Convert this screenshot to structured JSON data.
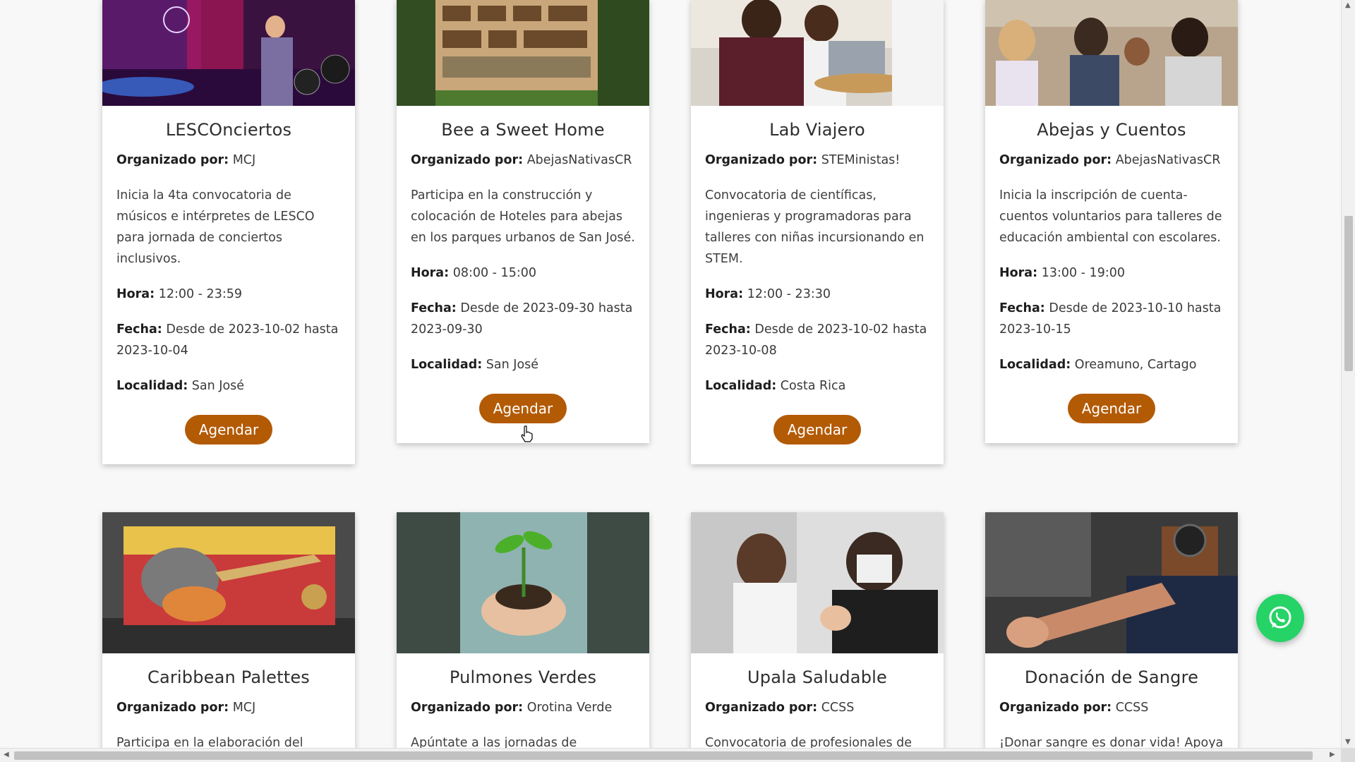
{
  "labels": {
    "organizer": "Organizado por:",
    "hour": "Hora:",
    "date": "Fecha:",
    "location": "Localidad:",
    "button": "Agendar"
  },
  "events": [
    {
      "title": "LESCOnciertos",
      "organizer": "MCJ",
      "description": "Inicia la 4ta convocatoria de músicos e intérpretes de LESCO para jornada de conciertos inclusivos.",
      "hour": "12:00 - 23:59",
      "date": "Desde de 2023-10-02 hasta 2023-10-04",
      "location": "San José"
    },
    {
      "title": "Bee a Sweet Home",
      "organizer": "AbejasNativasCR",
      "description": "Participa en la construcción y colocación de Hoteles para abejas en los parques urbanos de San José.",
      "hour": "08:00 - 15:00",
      "date": "Desde de 2023-09-30 hasta 2023-09-30",
      "location": "San José"
    },
    {
      "title": "Lab Viajero",
      "organizer": "STEMinistas!",
      "description": "Convocatoria de científicas, ingenieras y programadoras para talleres con niñas incursionando en STEM.",
      "hour": "12:00 - 23:30",
      "date": "Desde de 2023-10-02 hasta 2023-10-08",
      "location": "Costa Rica"
    },
    {
      "title": "Abejas y Cuentos",
      "organizer": "AbejasNativasCR",
      "description": "Inicia la inscripción de cuenta-cuentos voluntarios para talleres de educación ambiental con escolares.",
      "hour": "13:00 - 19:00",
      "date": "Desde de 2023-10-10 hasta 2023-10-15",
      "location": "Oreamuno, Cartago"
    },
    {
      "title": "Caribbean Palettes",
      "organizer": "MCJ",
      "description": "Participa en la elaboración del"
    },
    {
      "title": "Pulmones Verdes",
      "organizer": "Orotina Verde",
      "description": "Apúntate a las jornadas de"
    },
    {
      "title": "Upala Saludable",
      "organizer": "CCSS",
      "description": "Convocatoria de profesionales de"
    },
    {
      "title": "Donación de Sangre",
      "organizer": "CCSS",
      "description": "¡Donar sangre es donar vida! Apoya"
    }
  ],
  "colors": {
    "button": "#b35a05",
    "whatsapp": "#25d366"
  },
  "icons": [
    "whatsapp-icon",
    "hand-pointer-icon"
  ]
}
